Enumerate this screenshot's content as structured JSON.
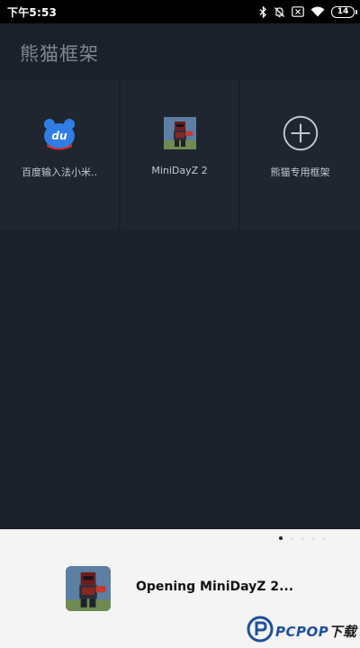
{
  "status_bar": {
    "time": "下午5:53",
    "battery": "14",
    "icons": [
      "bluetooth-icon",
      "mute-icon",
      "sim-blocked-icon",
      "wifi-icon",
      "battery-icon"
    ]
  },
  "app": {
    "title": "熊猫框架",
    "apps": [
      {
        "label": "百度输入法小米..",
        "icon": "baidu-ime-icon"
      },
      {
        "label": "MiniDayZ 2",
        "icon": "minidayz-icon"
      },
      {
        "label": "熊猫专用框架",
        "icon": "add-circle-icon"
      }
    ]
  },
  "toast": {
    "message": "Opening MiniDayZ 2...",
    "icon": "minidayz-icon",
    "page_dots": 5,
    "active_dot": 1
  },
  "watermark": {
    "text": "PCPOP",
    "suffix": "下载",
    "logo": "pcpop-logo"
  },
  "colors": {
    "background": "#1b202a",
    "tile": "#20262f",
    "toast_bg": "#f4f4f4",
    "brand_blue": "#1f4f9d"
  }
}
